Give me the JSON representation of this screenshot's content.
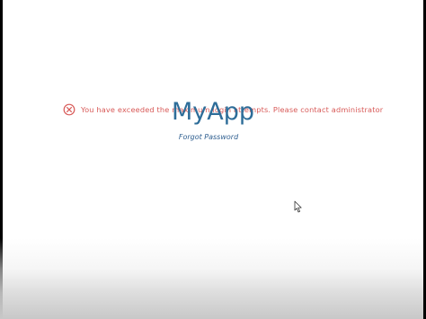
{
  "error": {
    "message": "You have exceeded the maximum login attempts. Please contact administrator",
    "icon": "error-circle-x-icon",
    "color": "#d85a58"
  },
  "app": {
    "title": "MyApp",
    "title_color": "#2e6d99"
  },
  "links": {
    "forgot_password": "Forgot Password"
  },
  "cursor": {
    "icon": "mouse-pointer-icon"
  }
}
